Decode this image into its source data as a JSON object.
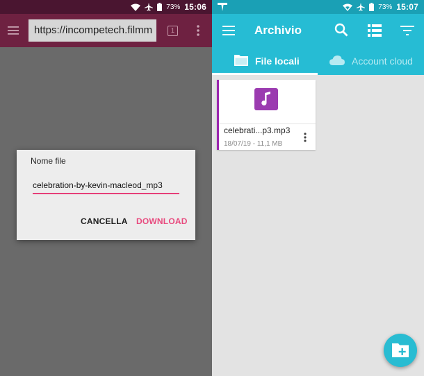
{
  "left": {
    "status": {
      "battery": "73%",
      "time": "15:06"
    },
    "browser": {
      "url": "https://incompetech.filmm",
      "tabs_count": "1"
    },
    "dialog": {
      "title": "Nome file",
      "filename": "celebration-by-kevin-macleod_mp3",
      "cancel_label": "CANCELLA",
      "download_label": "DOWNLOAD"
    },
    "colors": {
      "toolbar": "#6e2141",
      "accent": "#e84a7e"
    }
  },
  "right": {
    "status": {
      "battery": "73%",
      "time": "15:07"
    },
    "appbar": {
      "title": "Archivio"
    },
    "tabs": [
      {
        "label": "File locali",
        "icon": "folder-icon",
        "selected": true
      },
      {
        "label": "Account cloud",
        "icon": "cloud-icon",
        "selected": false
      }
    ],
    "file": {
      "name": "celebrati...p3.mp3",
      "meta": "18/07/19 - 11,1 MB",
      "icon": "music-note-icon"
    },
    "fab": {
      "icon": "new-folder-icon"
    },
    "colors": {
      "primary": "#26bcd4",
      "file_accent": "#9c27b0"
    }
  }
}
